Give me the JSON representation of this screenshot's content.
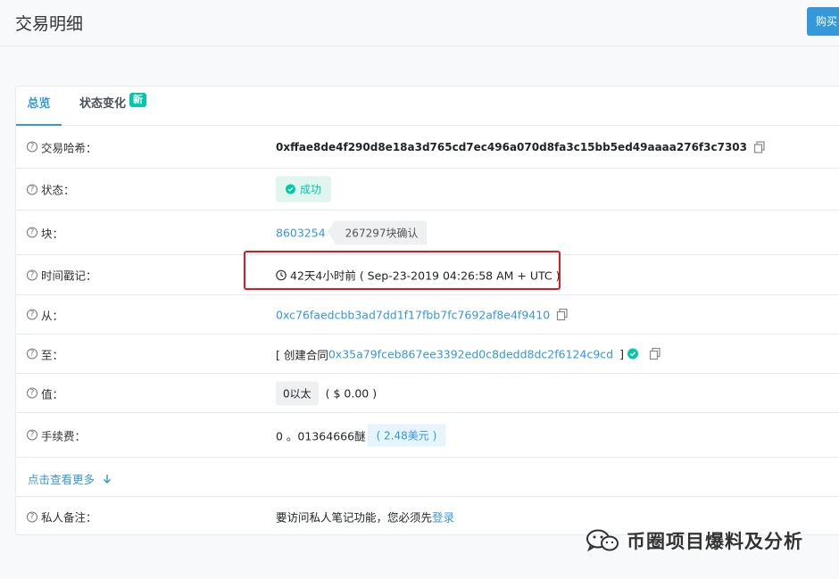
{
  "header": {
    "title": "交易明细",
    "buy_label": "购买"
  },
  "tabs": {
    "overview": "总览",
    "state_changes": "状态变化",
    "new_badge": "新"
  },
  "rows": {
    "tx_hash": {
      "label": "交易哈希：",
      "value": "0xffae8de4f290d8e18a3d765cd7ec496a070d8fa3c15bb5ed49aaaa276f3c7303"
    },
    "status": {
      "label": "状态：",
      "value": "成功"
    },
    "block": {
      "label": "块：",
      "value": "8603254",
      "confirmations": "267297块确认"
    },
    "timestamp": {
      "label": "时间戳记：",
      "value": "42天4小时前 ( Sep-23-2019 04:26:58 AM + UTC )"
    },
    "from": {
      "label": "从：",
      "value": "0xc76faedcbb3ad7dd1f17fbb7fc7692af8e4f9410"
    },
    "to": {
      "label": "至：",
      "prefix": "[ 创建合同",
      "value": "0x35a79fceb867ee3392ed0c8dedd8dc2f6124c9cd",
      "suffix": "]"
    },
    "value": {
      "label": "值：",
      "amount": "0以太",
      "usd": "( $ 0.00 )"
    },
    "fee": {
      "label": "手续费：",
      "amount": "0 。01364666醚",
      "usd": "( 2.48美元 )"
    },
    "more": {
      "label": "点击查看更多"
    },
    "note": {
      "label": "私人备注：",
      "text": "要访问私人笔记功能，您必须先",
      "login": "登录"
    }
  },
  "watermark": {
    "text": "币圈项目爆料及分析"
  },
  "colors": {
    "accent": "#3498db",
    "success": "#00c9a7",
    "highlight": "#e0191f"
  }
}
